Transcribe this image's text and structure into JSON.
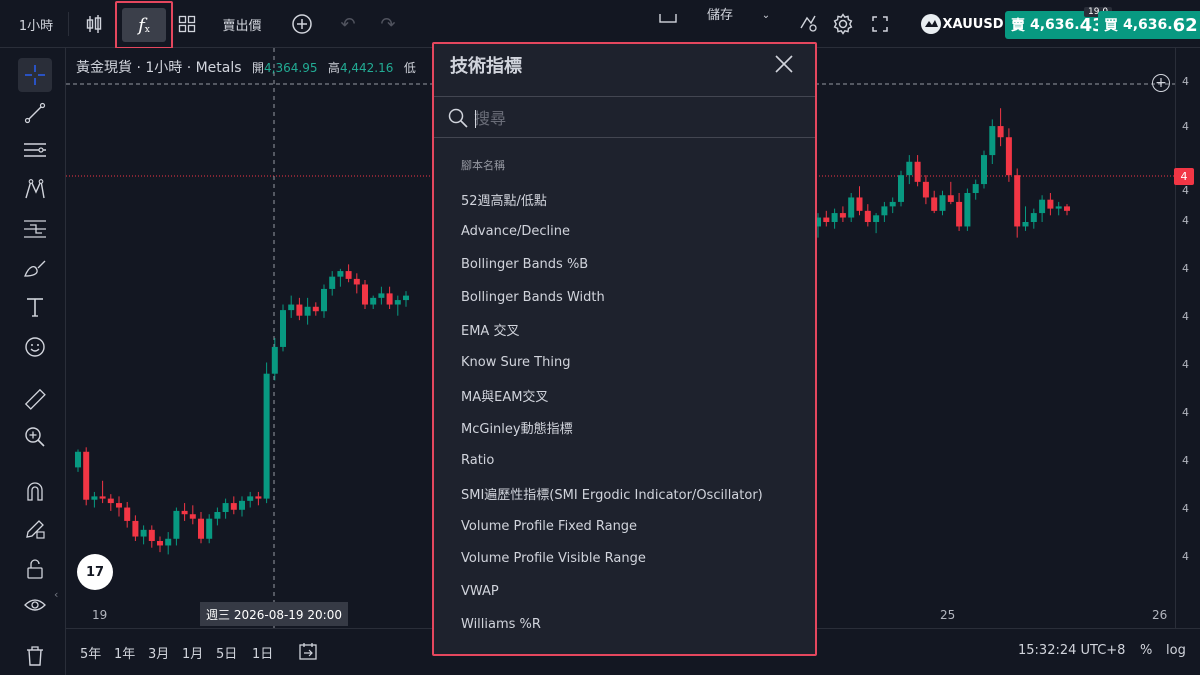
{
  "toolbar": {
    "interval": "1小時",
    "price_type": "賣出價",
    "save_partial": "儲存",
    "symbol": "XAUUSD",
    "spread": "19.0",
    "sell": {
      "label": "賣",
      "price_main": "4,636.",
      "price_big": "43"
    },
    "buy": {
      "label": "買",
      "price_main": "4,636.",
      "price_big": "62"
    }
  },
  "legend": {
    "title": "黃金現貨 · 1小時 · Metals",
    "open_label": "開",
    "open_value": "4,364.95",
    "high_label": "高",
    "high_value": "4,442.16",
    "cutoff": "低"
  },
  "price_axis": {
    "tick_glyph": "4",
    "current_tag": "4"
  },
  "time_axis": {
    "ticks": [
      "19",
      "25",
      "26"
    ],
    "crosshair_label": "週三 2026-08-19   20:00"
  },
  "bottom_bar": {
    "ranges": [
      "5年",
      "1年",
      "3月",
      "1月",
      "5日",
      "1日"
    ],
    "clock": "15:32:24 UTC+8",
    "percent": "%",
    "log": "log"
  },
  "logo_text": "17",
  "dialog": {
    "title": "技術指標",
    "search_placeholder": "搜尋",
    "section": "腳本名稱",
    "items": [
      "52週高點/低點",
      "Advance/Decline",
      "Bollinger Bands %B",
      "Bollinger Bands Width",
      "EMA 交叉",
      "Know Sure Thing",
      "MA與EAM交叉",
      "McGinley動態指標",
      "Ratio",
      "SMI遍歷性指標(SMI Ergodic Indicator/Oscillator)",
      "Volume Profile Fixed Range",
      "Volume Profile Visible Range",
      "VWAP",
      "Williams %R"
    ]
  },
  "colors": {
    "up": "#089981",
    "down": "#f23645",
    "highlight": "#e5475e",
    "background": "#131722",
    "panel": "#1e222d"
  },
  "chart_data": {
    "type": "candlestick",
    "title": "黃金現貨 · 1小時 · Metals",
    "x_ticks": [
      "19",
      "25",
      "26"
    ],
    "candles_left": [
      [
        4384,
        4400,
        4380,
        4398
      ],
      [
        4398,
        4402,
        4350,
        4355
      ],
      [
        4355,
        4362,
        4348,
        4358
      ],
      [
        4358,
        4372,
        4352,
        4356
      ],
      [
        4356,
        4360,
        4345,
        4352
      ],
      [
        4352,
        4358,
        4340,
        4348
      ],
      [
        4348,
        4353,
        4330,
        4336
      ],
      [
        4336,
        4341,
        4318,
        4322
      ],
      [
        4322,
        4332,
        4315,
        4328
      ],
      [
        4328,
        4332,
        4312,
        4318
      ],
      [
        4318,
        4322,
        4308,
        4314
      ],
      [
        4314,
        4326,
        4306,
        4320
      ],
      [
        4320,
        4348,
        4314,
        4345
      ],
      [
        4345,
        4352,
        4336,
        4342
      ],
      [
        4342,
        4350,
        4333,
        4338
      ],
      [
        4338,
        4344,
        4316,
        4320
      ],
      [
        4320,
        4342,
        4316,
        4338
      ],
      [
        4338,
        4348,
        4332,
        4344
      ],
      [
        4344,
        4356,
        4338,
        4352
      ],
      [
        4352,
        4358,
        4342,
        4346
      ],
      [
        4346,
        4358,
        4340,
        4354
      ],
      [
        4354,
        4362,
        4348,
        4358
      ],
      [
        4358,
        4362,
        4350,
        4356
      ],
      [
        4356,
        4478,
        4352,
        4468
      ],
      [
        4468,
        4500,
        4462,
        4492
      ],
      [
        4492,
        4530,
        4488,
        4525
      ],
      [
        4525,
        4538,
        4518,
        4530
      ],
      [
        4530,
        4536,
        4516,
        4520
      ],
      [
        4520,
        4536,
        4512,
        4528
      ],
      [
        4528,
        4532,
        4520,
        4524
      ],
      [
        4524,
        4548,
        4518,
        4544
      ],
      [
        4544,
        4560,
        4538,
        4555
      ],
      [
        4555,
        4562,
        4546,
        4560
      ],
      [
        4560,
        4566,
        4550,
        4553
      ],
      [
        4553,
        4558,
        4540,
        4548
      ],
      [
        4548,
        4552,
        4526,
        4530
      ],
      [
        4530,
        4538,
        4526,
        4536
      ],
      [
        4536,
        4546,
        4530,
        4540
      ],
      [
        4540,
        4546,
        4526,
        4530
      ],
      [
        4530,
        4538,
        4520,
        4534
      ],
      [
        4534,
        4542,
        4528,
        4538
      ]
    ],
    "candles_right": [
      [
        4600,
        4612,
        4590,
        4608
      ],
      [
        4608,
        4614,
        4600,
        4604
      ],
      [
        4604,
        4616,
        4598,
        4612
      ],
      [
        4612,
        4618,
        4604,
        4608
      ],
      [
        4608,
        4630,
        4604,
        4626
      ],
      [
        4626,
        4636,
        4610,
        4614
      ],
      [
        4614,
        4620,
        4600,
        4604
      ],
      [
        4604,
        4612,
        4594,
        4610
      ],
      [
        4610,
        4622,
        4604,
        4618
      ],
      [
        4618,
        4626,
        4612,
        4622
      ],
      [
        4622,
        4650,
        4618,
        4646
      ],
      [
        4646,
        4664,
        4638,
        4658
      ],
      [
        4658,
        4664,
        4636,
        4640
      ],
      [
        4640,
        4646,
        4620,
        4626
      ],
      [
        4626,
        4632,
        4612,
        4614
      ],
      [
        4614,
        4632,
        4610,
        4628
      ],
      [
        4628,
        4640,
        4620,
        4622
      ],
      [
        4622,
        4630,
        4596,
        4600
      ],
      [
        4600,
        4634,
        4596,
        4630
      ],
      [
        4630,
        4642,
        4624,
        4638
      ],
      [
        4638,
        4668,
        4634,
        4664
      ],
      [
        4664,
        4696,
        4656,
        4690
      ],
      [
        4690,
        4706,
        4672,
        4680
      ],
      [
        4680,
        4688,
        4640,
        4646
      ],
      [
        4646,
        4652,
        4590,
        4600
      ],
      [
        4600,
        4618,
        4596,
        4604
      ],
      [
        4604,
        4616,
        4598,
        4612
      ],
      [
        4612,
        4628,
        4604,
        4624
      ],
      [
        4624,
        4630,
        4610,
        4616
      ],
      [
        4616,
        4622,
        4610,
        4618
      ],
      [
        4618,
        4620,
        4610,
        4614
      ]
    ]
  }
}
